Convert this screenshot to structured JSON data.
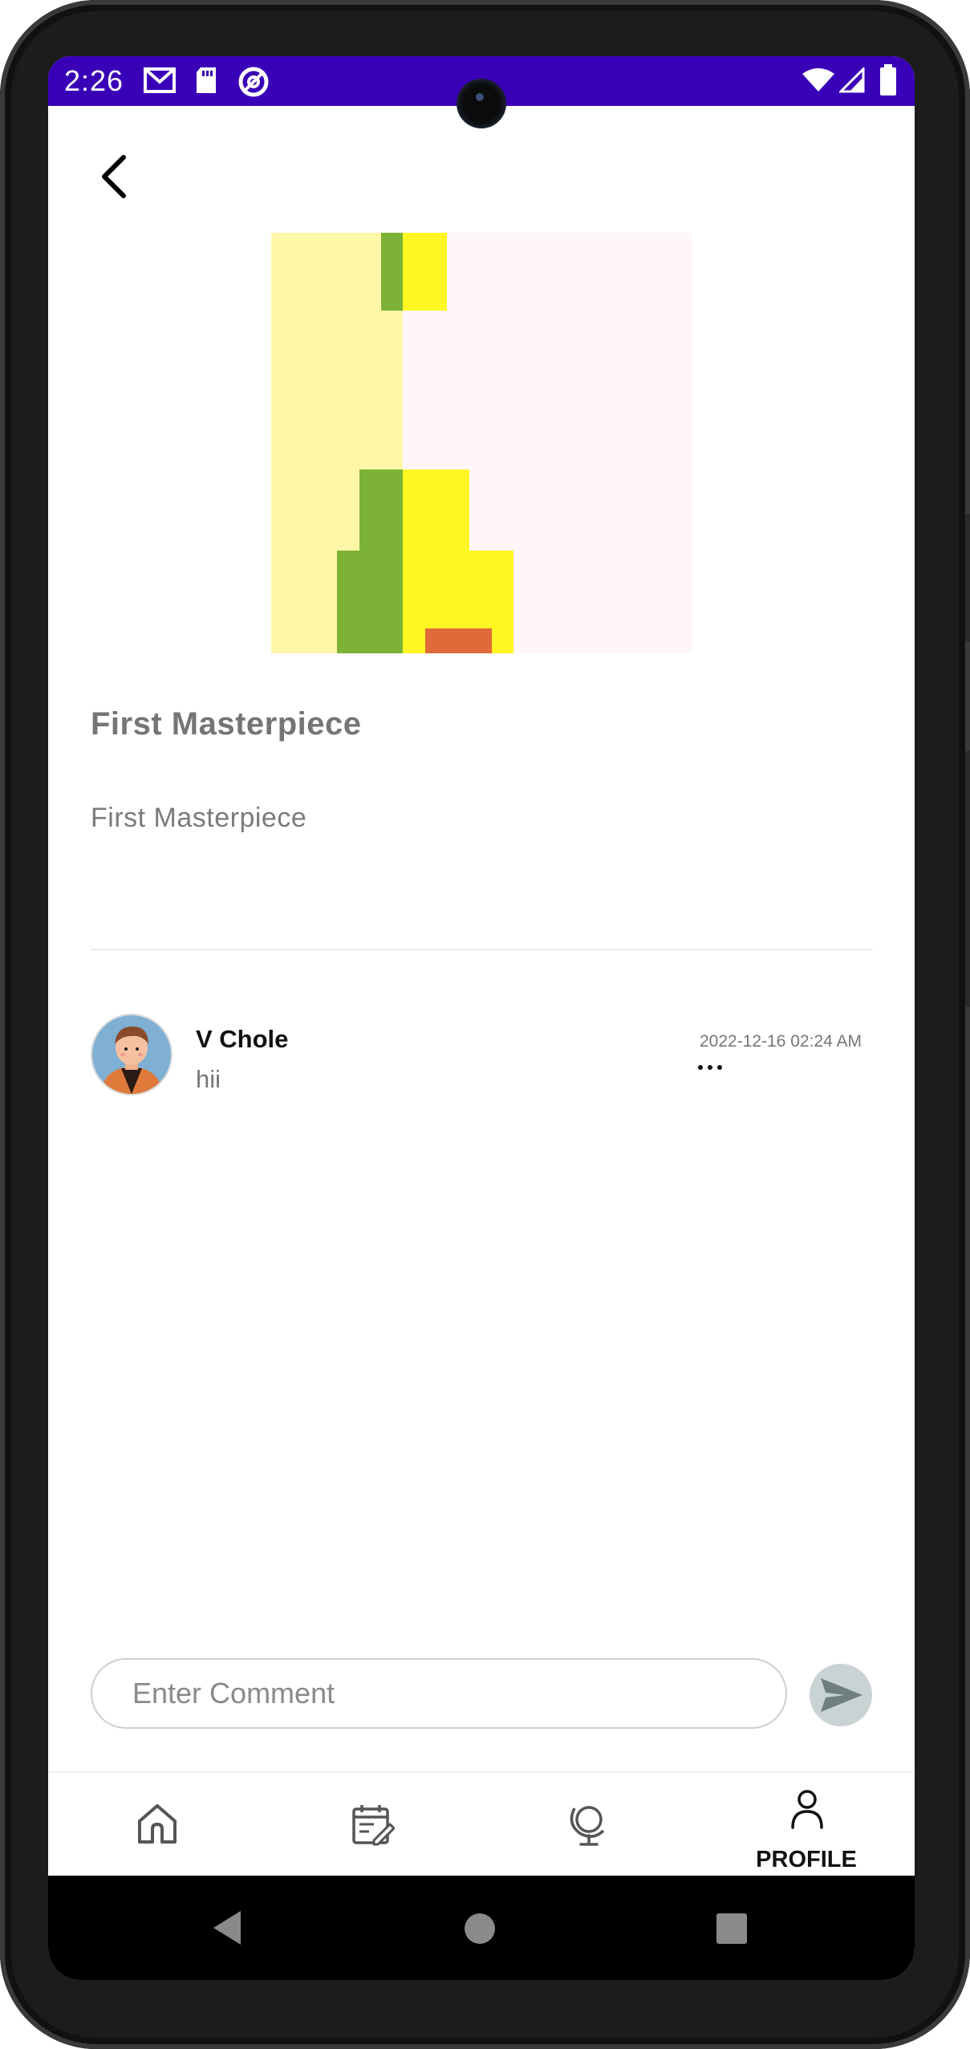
{
  "status_bar": {
    "time": "2:26",
    "icons": [
      "gmail-icon",
      "sd-card-icon",
      "at-sign-icon",
      "wifi-icon",
      "signal-icon",
      "battery-icon"
    ],
    "background": "#3a00b8"
  },
  "post": {
    "title": "First Masterpiece",
    "description": "First Masterpiece"
  },
  "comments": [
    {
      "author": "V Chole",
      "text": "hii",
      "timestamp": "2022-12-16 02:24 AM"
    }
  ],
  "comment_box": {
    "placeholder": "Enter Comment"
  },
  "bottom_nav": {
    "items": [
      {
        "icon": "home-icon",
        "label": ""
      },
      {
        "icon": "calendar-edit-icon",
        "label": ""
      },
      {
        "icon": "globe-icon",
        "label": ""
      },
      {
        "icon": "profile-icon",
        "label": "PROFILE"
      }
    ],
    "active_index": 3
  },
  "colors": {
    "accent": "#3a00b8",
    "send_button": "#c9d3d3"
  }
}
